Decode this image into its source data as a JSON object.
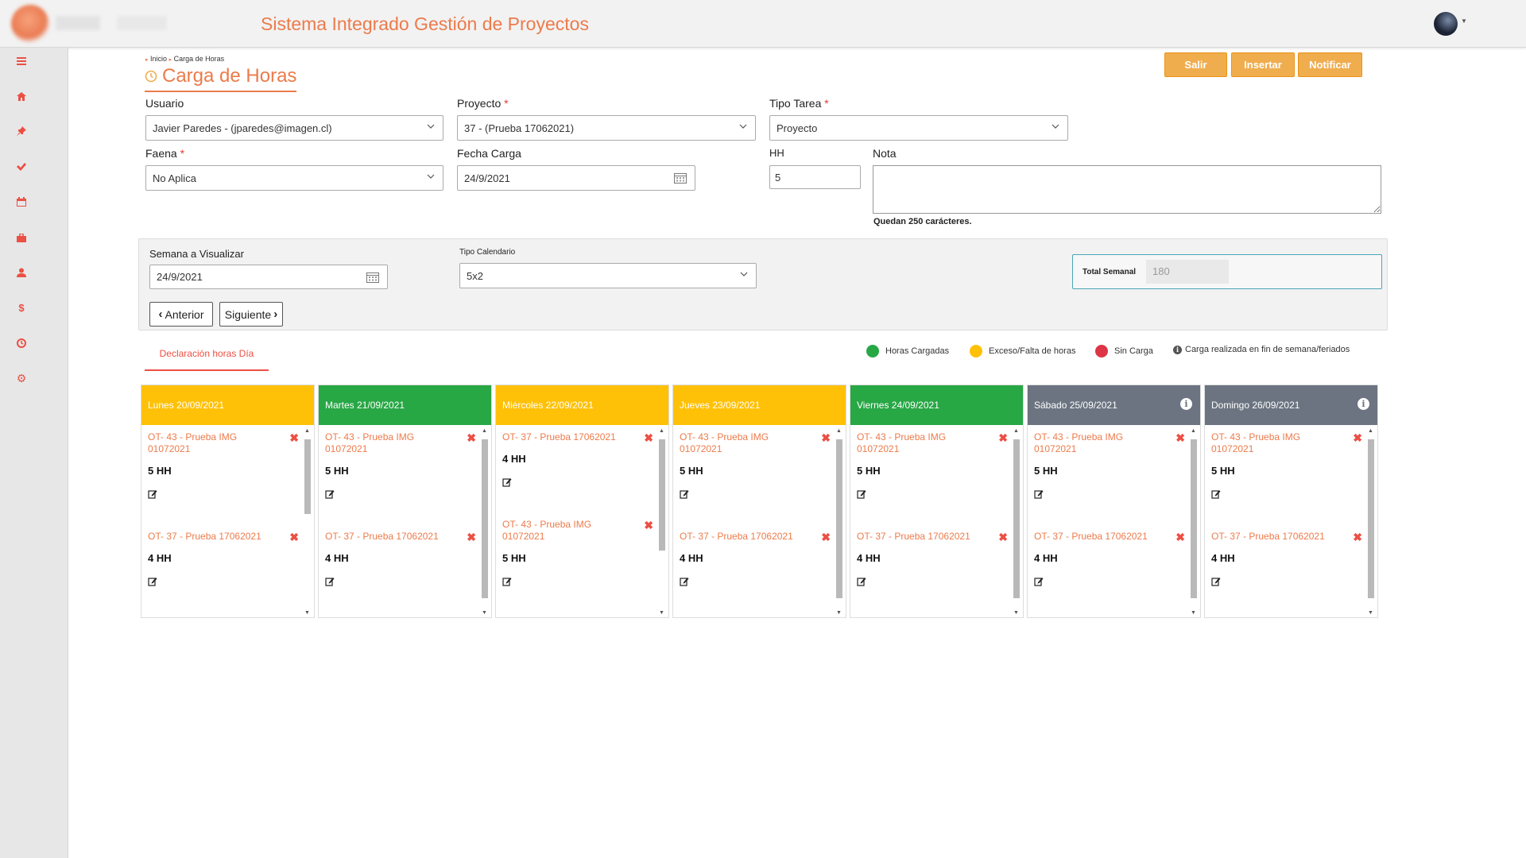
{
  "app": {
    "title": "Sistema Integrado Gestión de Proyectos"
  },
  "breadcrumb": {
    "home": "Inicio",
    "current": "Carga de Horas"
  },
  "page": {
    "title": "Carga de Horas"
  },
  "actions": {
    "salir": "Salir",
    "insertar": "Insertar",
    "notificar": "Notificar"
  },
  "sidebar": {
    "items": [
      "menu-icon",
      "home-icon",
      "pin-icon",
      "check-icon",
      "calendar-icon",
      "briefcase-icon",
      "user-icon",
      "dollar-icon",
      "clock-icon",
      "gear-icon"
    ]
  },
  "form": {
    "usuario": {
      "label": "Usuario",
      "value": "Javier  Paredes - (jparedes@imagen.cl)"
    },
    "proyecto": {
      "label": "Proyecto",
      "required": "*",
      "value": "37 - (Prueba 17062021)"
    },
    "tipo_tarea": {
      "label": "Tipo Tarea",
      "required": "*",
      "value": "Proyecto"
    },
    "faena": {
      "label": "Faena",
      "required": "*",
      "value": "No Aplica"
    },
    "fecha_carga": {
      "label": "Fecha Carga",
      "value": "24/9/2021"
    },
    "hh": {
      "label": "HH",
      "value": "5"
    },
    "nota": {
      "label": "Nota",
      "value": "",
      "chars_left": "Quedan 250 carácteres."
    }
  },
  "week": {
    "semana_label": "Semana a Visualizar",
    "semana_value": "24/9/2021",
    "tipo_calendario_label": "Tipo Calendario",
    "tipo_calendario_value": "5x2",
    "total_label": "Total Semanal",
    "total_value": "180",
    "prev": "Anterior",
    "next": "Siguiente"
  },
  "tab": {
    "label": "Declaración horas Día"
  },
  "legend": {
    "cargadas": "Horas Cargadas",
    "exceso": "Exceso/Falta de horas",
    "sin_carga": "Sin Carga",
    "fin_semana": "Carga realizada en fin de semana/feriados"
  },
  "colors": {
    "accent": "#ec7b4b",
    "green": "#28a745",
    "yellow": "#ffc107",
    "red": "#dc3545",
    "grey": "#6b7480",
    "button": "#f0ad4e"
  },
  "days": [
    {
      "title": "Lunes 20/09/2021",
      "status": "yellow",
      "weekend": false,
      "entries": [
        {
          "ot": "OT- 43 - Prueba IMG 01072021",
          "hh": "5 HH"
        },
        {
          "ot": "OT- 37 - Prueba 17062021",
          "hh": "4 HH"
        }
      ]
    },
    {
      "title": "Martes 21/09/2021",
      "status": "green",
      "weekend": false,
      "entries": [
        {
          "ot": "OT- 43 - Prueba IMG 01072021",
          "hh": "5 HH"
        },
        {
          "ot": "OT- 37 - Prueba 17062021",
          "hh": "4 HH"
        }
      ]
    },
    {
      "title": "Miércoles 22/09/2021",
      "status": "yellow",
      "weekend": false,
      "entries": [
        {
          "ot": "OT- 37 - Prueba 17062021",
          "hh": "4 HH"
        },
        {
          "ot": "OT- 43 - Prueba IMG 01072021",
          "hh": "5 HH"
        }
      ]
    },
    {
      "title": "Jueves 23/09/2021",
      "status": "yellow",
      "weekend": false,
      "entries": [
        {
          "ot": "OT- 43 - Prueba IMG 01072021",
          "hh": "5 HH"
        },
        {
          "ot": "OT- 37 - Prueba 17062021",
          "hh": "4 HH"
        }
      ]
    },
    {
      "title": "Viernes 24/09/2021",
      "status": "green",
      "weekend": false,
      "entries": [
        {
          "ot": "OT- 43 - Prueba IMG 01072021",
          "hh": "5 HH"
        },
        {
          "ot": "OT- 37 - Prueba 17062021",
          "hh": "4 HH"
        }
      ]
    },
    {
      "title": "Sábado 25/09/2021",
      "status": "grey",
      "weekend": true,
      "entries": [
        {
          "ot": "OT- 43 - Prueba IMG 01072021",
          "hh": "5 HH"
        },
        {
          "ot": "OT- 37 - Prueba 17062021",
          "hh": "4 HH"
        }
      ]
    },
    {
      "title": "Domingo 26/09/2021",
      "status": "grey",
      "weekend": true,
      "entries": [
        {
          "ot": "OT- 43 - Prueba IMG 01072021",
          "hh": "5 HH"
        },
        {
          "ot": "OT- 37 - Prueba 17062021",
          "hh": "4 HH"
        }
      ]
    }
  ]
}
